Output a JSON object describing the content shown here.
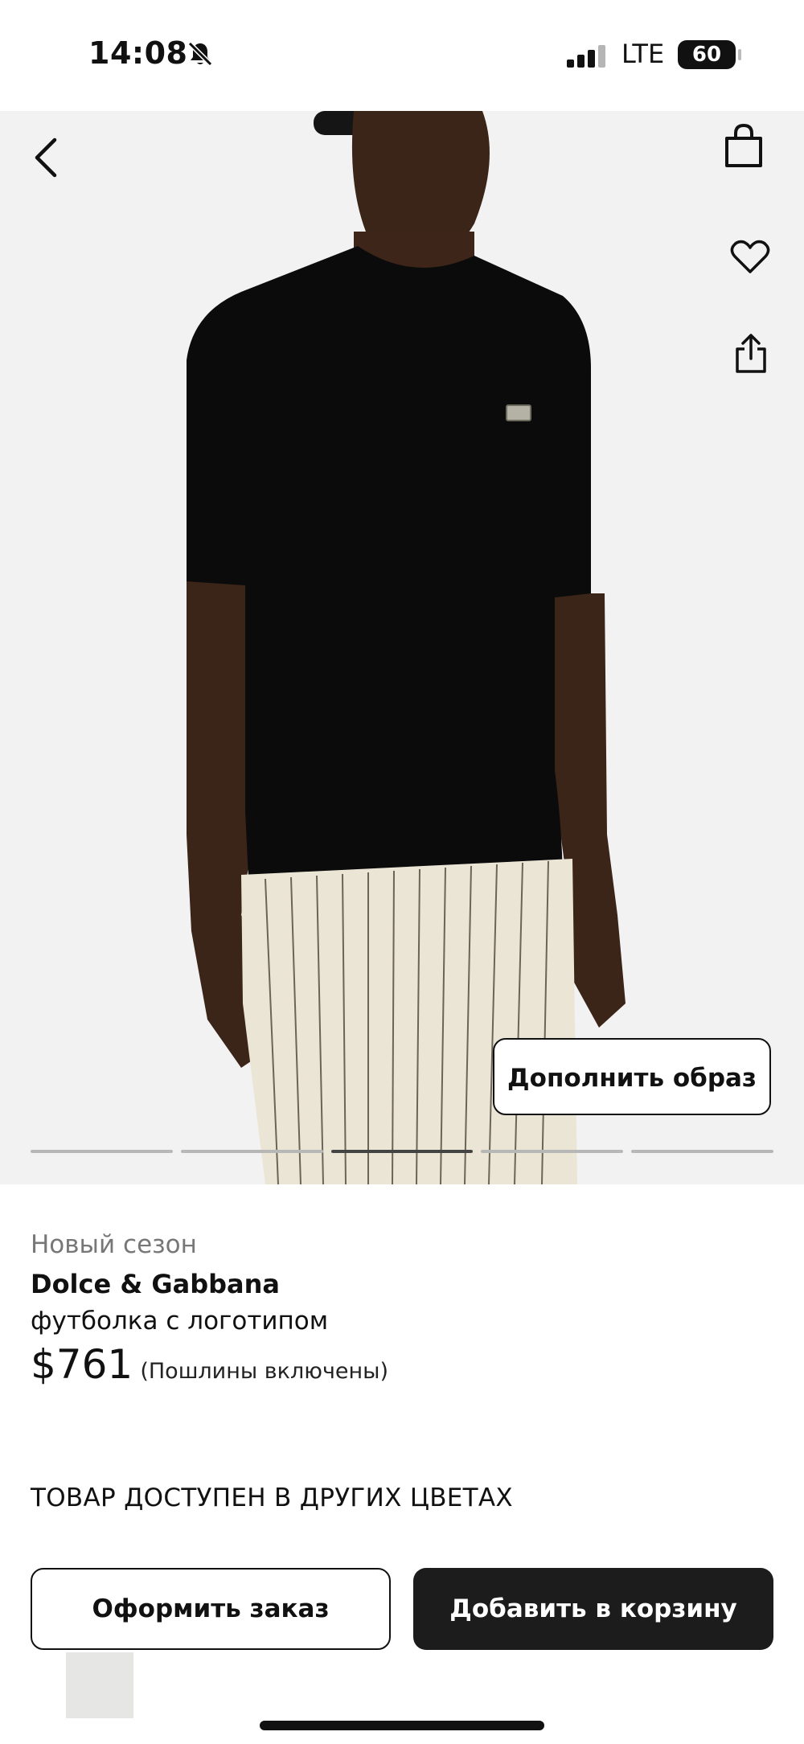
{
  "status_bar": {
    "time": "14:08",
    "network": "LTE",
    "battery": "60",
    "icons": [
      "bell-off-icon",
      "signal-icon"
    ]
  },
  "gallery": {
    "icons": [
      "back-icon",
      "bag-icon",
      "heart-icon",
      "share-icon"
    ],
    "complete_look_label": "Дополнить образ",
    "pager": {
      "total": 5,
      "active": 3
    }
  },
  "product": {
    "season_label": "Новый сезон",
    "brand": "Dolce & Gabbana",
    "name": "футболка с логотипом",
    "price": "$761",
    "duties_note": "(Пошлины включены)"
  },
  "other_colors_label": "ТОВАР ДОСТУПЕН В ДРУГИХ ЦВЕТАХ",
  "actions": {
    "order_label": "Оформить заказ",
    "cart_label": "Добавить в корзину"
  },
  "colors": {
    "primary": "#1c1c1c",
    "muted_text": "#777777",
    "photo_background": "#f2f2f2"
  }
}
